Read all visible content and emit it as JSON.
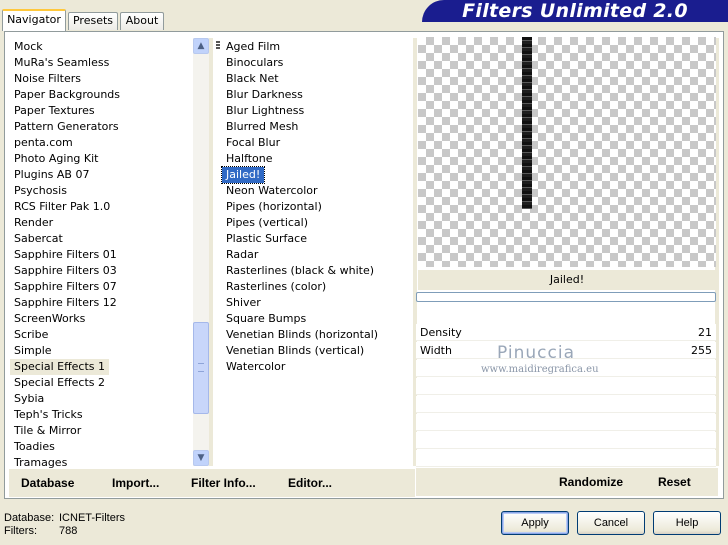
{
  "tabs": [
    "Navigator",
    "Presets",
    "About"
  ],
  "banner_title": "Filters Unlimited 2.0",
  "categories": [
    "Mock",
    "MuRa's Seamless",
    "Noise Filters",
    "Paper Backgrounds",
    "Paper Textures",
    "Pattern Generators",
    "penta.com",
    "Photo Aging Kit",
    "Plugins AB 07",
    "Psychosis",
    "RCS Filter Pak 1.0",
    "Render",
    "Sabercat",
    "Sapphire Filters 01",
    "Sapphire Filters 03",
    "Sapphire Filters 07",
    "Sapphire Filters 12",
    "ScreenWorks",
    "Scribe",
    "Simple",
    "Special Effects 1",
    "Special Effects 2",
    "Sybia",
    "Teph's Tricks",
    "Tile & Mirror",
    "Toadies",
    "Tramages"
  ],
  "selected_category": "Special Effects 1",
  "filters": [
    "Aged Film",
    "Binoculars",
    "Black Net",
    "Blur Darkness",
    "Blur Lightness",
    "Blurred Mesh",
    "Focal Blur",
    "Halftone",
    "Jailed!",
    "Neon Watercolor",
    "Pipes (horizontal)",
    "Pipes (vertical)",
    "Plastic Surface",
    "Radar",
    "Rasterlines (black & white)",
    "Rasterlines (color)",
    "Shiver",
    "Square Bumps",
    "Venetian Blinds (horizontal)",
    "Venetian Blinds (vertical)",
    "Watercolor"
  ],
  "selected_filter": "Jailed!",
  "left_buttons": {
    "database": "Database",
    "import": "Import...",
    "filter_info": "Filter Info...",
    "editor": "Editor..."
  },
  "current_filter_name": "Jailed!",
  "params": [
    {
      "label": "Density",
      "value": "21"
    },
    {
      "label": "Width",
      "value": "255"
    }
  ],
  "watermark": {
    "name": "Pinuccia",
    "url": "www.maidiregrafica.eu"
  },
  "right_buttons": {
    "randomize": "Randomize",
    "reset": "Reset"
  },
  "status": {
    "database_label": "Database:",
    "database_value": "ICNET-Filters",
    "filters_label": "Filters:",
    "filters_value": "788"
  },
  "dialog_buttons": {
    "apply": "Apply",
    "cancel": "Cancel",
    "help": "Help"
  }
}
